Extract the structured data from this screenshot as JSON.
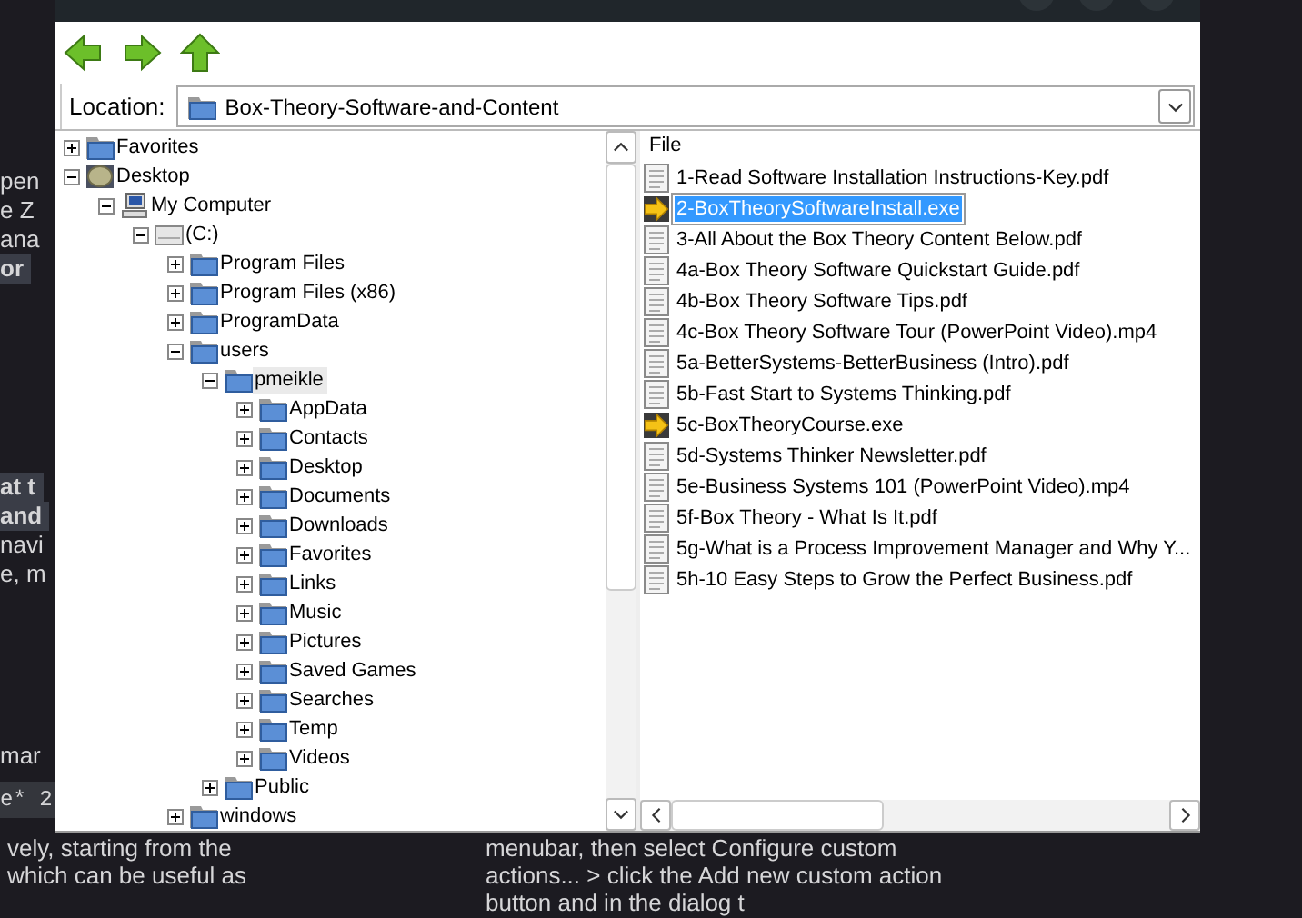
{
  "background": {
    "left_groups": [
      [
        {
          "text": "pen",
          "kind": "text"
        },
        {
          "text": "e Z",
          "kind": "text"
        },
        {
          "text": "ana",
          "kind": "text"
        },
        {
          "text": "or",
          "kind": "strong"
        }
      ],
      [
        {
          "text": "at t",
          "kind": "strong"
        },
        {
          "text": "and",
          "kind": "strong"
        },
        {
          "text": "navi",
          "kind": "text"
        },
        {
          "text": "e, m",
          "kind": "text"
        }
      ],
      [
        {
          "text": "mar",
          "kind": "text"
        },
        {
          "text": "e* 2",
          "kind": "code"
        }
      ]
    ],
    "bottom_left": [
      "vely, starting from the",
      " which can be useful as"
    ],
    "bottom_right": [
      "menubar, then select Configure custom",
      "actions... > click the Add new custom action",
      "button and in the dialog t"
    ]
  },
  "dialog": {
    "location": {
      "label": "Location:",
      "value": "Box-Theory-Software-and-Content"
    },
    "tree": [
      {
        "label": "Favorites",
        "kind": "folder",
        "expanded": false,
        "selected": false
      },
      {
        "label": "Desktop",
        "kind": "desktop",
        "expanded": true,
        "selected": false,
        "children": [
          {
            "label": "My Computer",
            "kind": "computer",
            "expanded": true,
            "selected": false,
            "children": [
              {
                "label": "(C:)",
                "kind": "drive",
                "expanded": true,
                "selected": false,
                "children": [
                  {
                    "label": "Program Files",
                    "kind": "folder",
                    "expanded": false,
                    "selected": false
                  },
                  {
                    "label": "Program Files (x86)",
                    "kind": "folder",
                    "expanded": false,
                    "selected": false
                  },
                  {
                    "label": "ProgramData",
                    "kind": "folder",
                    "expanded": false,
                    "selected": false
                  },
                  {
                    "label": "users",
                    "kind": "folder",
                    "expanded": true,
                    "selected": false,
                    "children": [
                      {
                        "label": "pmeikle",
                        "kind": "folder",
                        "expanded": true,
                        "selected": true,
                        "children": [
                          {
                            "label": "AppData",
                            "kind": "folder",
                            "expanded": false,
                            "selected": false
                          },
                          {
                            "label": "Contacts",
                            "kind": "folder",
                            "expanded": false,
                            "selected": false
                          },
                          {
                            "label": "Desktop",
                            "kind": "folder",
                            "expanded": false,
                            "selected": false
                          },
                          {
                            "label": "Documents",
                            "kind": "folder",
                            "expanded": false,
                            "selected": false
                          },
                          {
                            "label": "Downloads",
                            "kind": "folder",
                            "expanded": false,
                            "selected": false
                          },
                          {
                            "label": "Favorites",
                            "kind": "folder",
                            "expanded": false,
                            "selected": false
                          },
                          {
                            "label": "Links",
                            "kind": "folder",
                            "expanded": false,
                            "selected": false
                          },
                          {
                            "label": "Music",
                            "kind": "folder",
                            "expanded": false,
                            "selected": false
                          },
                          {
                            "label": "Pictures",
                            "kind": "folder",
                            "expanded": false,
                            "selected": false
                          },
                          {
                            "label": "Saved Games",
                            "kind": "folder",
                            "expanded": false,
                            "selected": false
                          },
                          {
                            "label": "Searches",
                            "kind": "folder",
                            "expanded": false,
                            "selected": false
                          },
                          {
                            "label": "Temp",
                            "kind": "folder",
                            "expanded": false,
                            "selected": false
                          },
                          {
                            "label": "Videos",
                            "kind": "folder",
                            "expanded": false,
                            "selected": false
                          }
                        ]
                      },
                      {
                        "label": "Public",
                        "kind": "folder",
                        "expanded": false,
                        "selected": false
                      }
                    ]
                  },
                  {
                    "label": "windows",
                    "kind": "folder",
                    "expanded": false,
                    "selected": false
                  }
                ]
              }
            ]
          }
        ]
      }
    ],
    "file_header": "File",
    "files": [
      {
        "name": "1-Read Software Installation Instructions-Key.pdf",
        "kind": "document",
        "selected": false
      },
      {
        "name": "2-BoxTheorySoftwareInstall.exe",
        "kind": "executable",
        "selected": true
      },
      {
        "name": "3-All About the Box Theory Content Below.pdf",
        "kind": "document",
        "selected": false
      },
      {
        "name": "4a-Box Theory Software Quickstart Guide.pdf",
        "kind": "document",
        "selected": false
      },
      {
        "name": "4b-Box Theory Software Tips.pdf",
        "kind": "document",
        "selected": false
      },
      {
        "name": "4c-Box Theory Software Tour (PowerPoint Video).mp4",
        "kind": "document",
        "selected": false
      },
      {
        "name": "5a-BetterSystems-BetterBusiness (Intro).pdf",
        "kind": "document",
        "selected": false
      },
      {
        "name": "5b-Fast Start to Systems Thinking.pdf",
        "kind": "document",
        "selected": false
      },
      {
        "name": "5c-BoxTheoryCourse.exe",
        "kind": "executable",
        "selected": false
      },
      {
        "name": "5d-Systems Thinker Newsletter.pdf",
        "kind": "document",
        "selected": false
      },
      {
        "name": "5e-Business Systems 101 (PowerPoint Video).mp4",
        "kind": "document",
        "selected": false
      },
      {
        "name": "5f-Box Theory - What Is It.pdf",
        "kind": "document",
        "selected": false
      },
      {
        "name": "5g-What is a Process Improvement Manager and Why Y...",
        "kind": "document",
        "selected": false
      },
      {
        "name": "5h-10 Easy Steps to Grow the Perfect Business.pdf",
        "kind": "document",
        "selected": false
      }
    ]
  }
}
